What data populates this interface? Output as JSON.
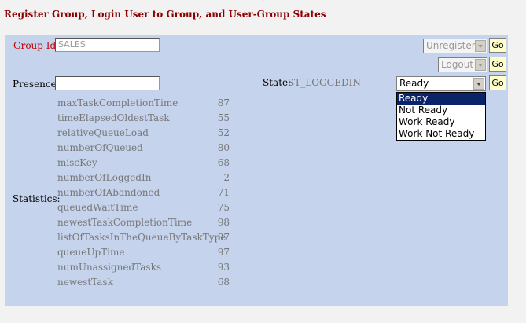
{
  "header": {
    "title": "Register Group, Login User to Group, and User-Group States"
  },
  "group": {
    "label": "Group Id:",
    "value": "SALES"
  },
  "register": {
    "selected": "Unregister",
    "go_label": "Go"
  },
  "logout": {
    "selected": "Logout",
    "go_label": "Go"
  },
  "presence": {
    "label": "Presence:",
    "value": ""
  },
  "state": {
    "label": "State:",
    "value": "ST_LOGGEDIN",
    "selected": "Ready",
    "go_label": "Go",
    "options": [
      "Ready",
      "Not Ready",
      "Work Ready",
      "Work Not Ready"
    ]
  },
  "statistics": {
    "label": "Statistics:",
    "rows": [
      {
        "name": "maxTaskCompletionTime",
        "value": "87"
      },
      {
        "name": "timeElapsedOldestTask",
        "value": "55"
      },
      {
        "name": "relativeQueueLoad",
        "value": "52"
      },
      {
        "name": "numberOfQueued",
        "value": "80"
      },
      {
        "name": "miscKey",
        "value": "68"
      },
      {
        "name": "numberOfLoggedIn",
        "value": "2"
      },
      {
        "name": "numberOfAbandoned",
        "value": "71"
      },
      {
        "name": "queuedWaitTime",
        "value": "75"
      },
      {
        "name": "newestTaskCompletionTime",
        "value": "98"
      },
      {
        "name": "listOfTasksInTheQueueByTaskType",
        "value": "87"
      },
      {
        "name": "queueUpTime",
        "value": "97"
      },
      {
        "name": "numUnassignedTasks",
        "value": "93"
      },
      {
        "name": "newestTask",
        "value": "68"
      }
    ]
  }
}
